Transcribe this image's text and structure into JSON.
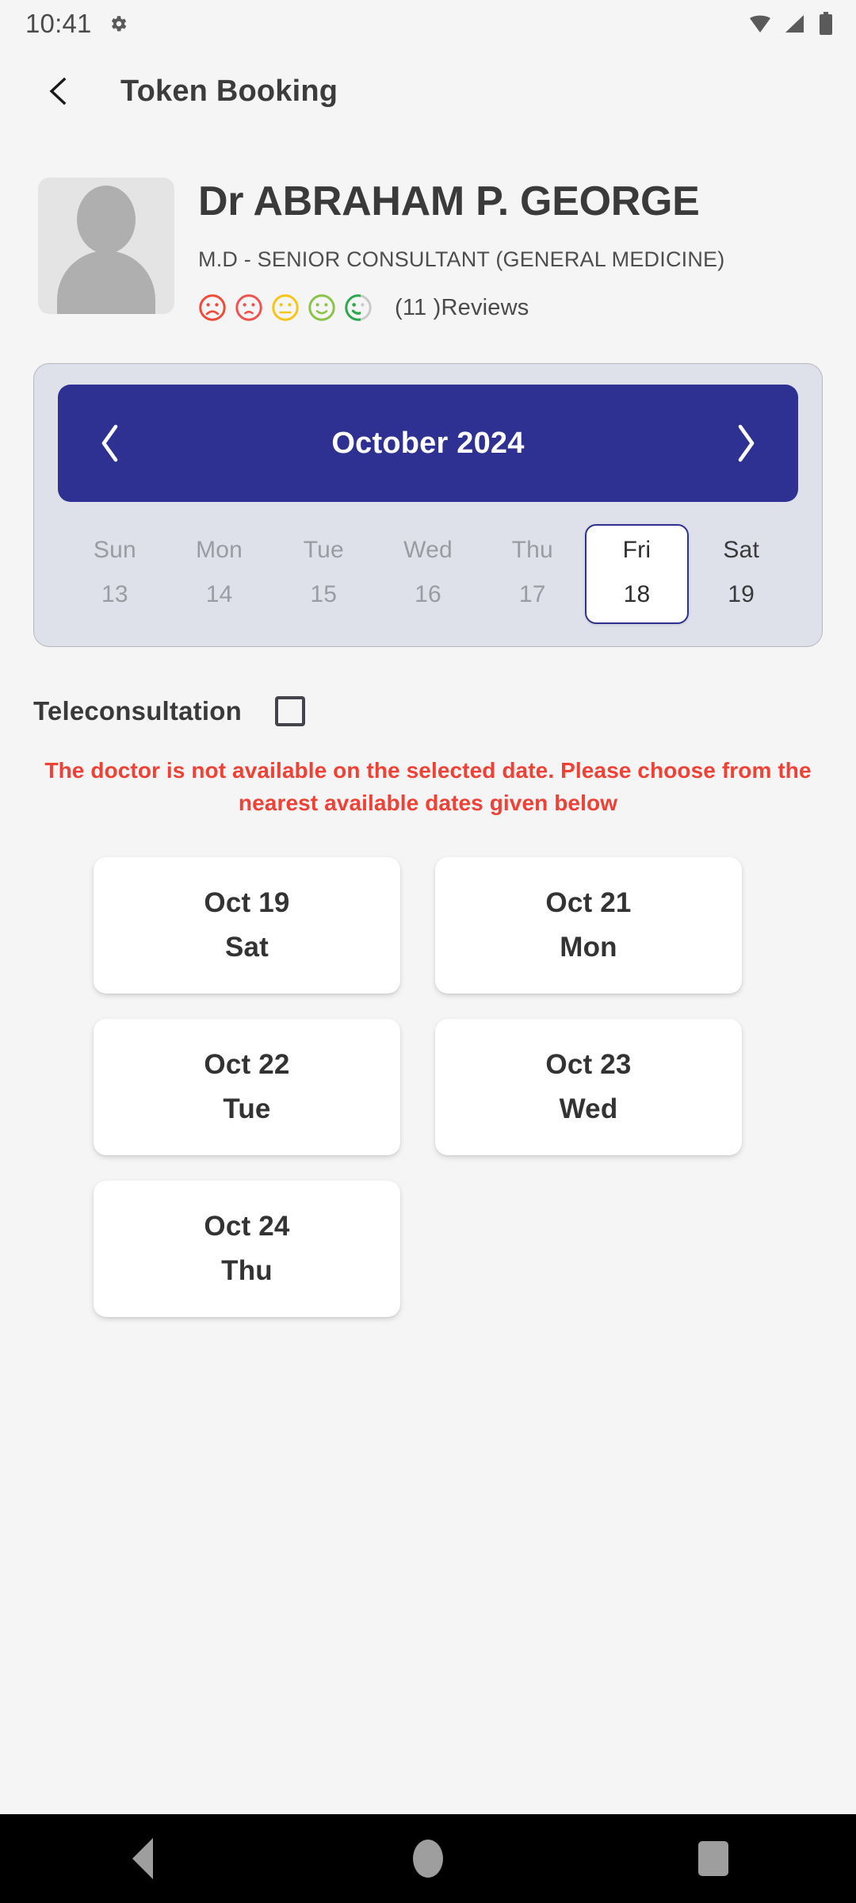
{
  "statusbar": {
    "time": "10:41",
    "icons": [
      "gear-icon",
      "wifi-icon",
      "cellular-signal-icon",
      "battery-icon"
    ]
  },
  "appbar": {
    "back_icon": "chevron-left-icon",
    "title": "Token Booking"
  },
  "doctor": {
    "avatar_icon": "person-placeholder-icon",
    "name": "Dr ABRAHAM P. GEORGE",
    "specialty": "M.D - SENIOR CONSULTANT (GENERAL MEDICINE)",
    "reviews_label": "(11 )Reviews",
    "rating_faces": [
      {
        "name": "face-very-sad-icon",
        "color": "#EE4B3A",
        "mouth": "frown",
        "filled": false
      },
      {
        "name": "face-sad-icon",
        "color": "#EF5350",
        "mouth": "small-frown",
        "filled": false
      },
      {
        "name": "face-neutral-icon",
        "color": "#F5C518",
        "mouth": "flat",
        "filled": false
      },
      {
        "name": "face-happy-icon",
        "color": "#8BC34A",
        "mouth": "smile",
        "filled": false
      },
      {
        "name": "face-very-happy-icon",
        "color": "#2EA84F",
        "mouth": "smile",
        "filled": true
      }
    ]
  },
  "calendar": {
    "prev_icon": "chevron-left-icon",
    "next_icon": "chevron-right-icon",
    "month": "October 2024",
    "header_color": "#2E3192",
    "days": [
      {
        "name": "Sun",
        "num": "13",
        "state": "disabled"
      },
      {
        "name": "Mon",
        "num": "14",
        "state": "disabled"
      },
      {
        "name": "Tue",
        "num": "15",
        "state": "disabled"
      },
      {
        "name": "Wed",
        "num": "16",
        "state": "disabled"
      },
      {
        "name": "Thu",
        "num": "17",
        "state": "disabled"
      },
      {
        "name": "Fri",
        "num": "18",
        "state": "selected"
      },
      {
        "name": "Sat",
        "num": "19",
        "state": "enabled"
      }
    ]
  },
  "teleconsultation": {
    "label": "Teleconsultation",
    "checked": false
  },
  "warning": {
    "text": "The doctor is not available on the selected date. Please choose from the nearest available dates given below",
    "color": "#EF4136"
  },
  "available_dates": [
    {
      "date": "Oct 19",
      "day": "Sat"
    },
    {
      "date": "Oct 21",
      "day": "Mon"
    },
    {
      "date": "Oct 22",
      "day": "Tue"
    },
    {
      "date": "Oct 23",
      "day": "Wed"
    },
    {
      "date": "Oct 24",
      "day": "Thu"
    }
  ],
  "navbar": {
    "back": "back-triangle-icon",
    "home": "home-circle-icon",
    "recents": "recents-square-icon"
  }
}
